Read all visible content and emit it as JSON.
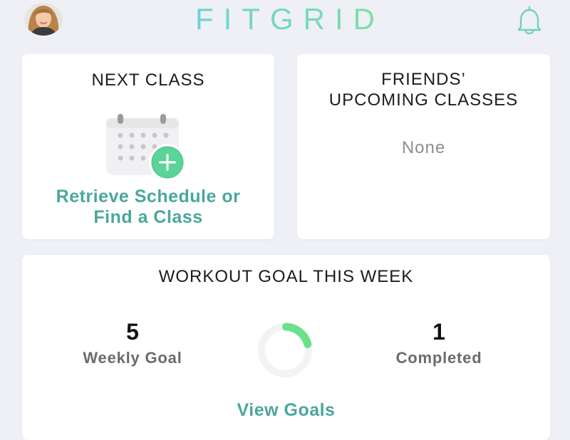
{
  "header": {
    "logo_text": "FITGRID",
    "icons": {
      "avatar": "user-avatar",
      "notifications": "bell-icon"
    }
  },
  "next_class": {
    "title": "NEXT CLASS",
    "icon": "calendar-add-icon",
    "link_line1": "Retrieve Schedule or",
    "link_line2": "Find a Class"
  },
  "friends": {
    "title_line1": "FRIENDS’",
    "title_line2": "UPCOMING CLASSES",
    "empty_text": "None"
  },
  "workout_goal": {
    "title": "WORKOUT GOAL THIS WEEK",
    "weekly_goal_value": "5",
    "weekly_goal_label": "Weekly Goal",
    "completed_value": "1",
    "completed_label": "Completed",
    "progress_fraction": 0.2,
    "view_goals_label": "View Goals"
  },
  "colors": {
    "logo_gradient_start": "#6fd1d8",
    "logo_gradient_end": "#7ee0a2",
    "link": "#4aa79b",
    "progress": "#6be08a",
    "ring_track": "#f2f3f5",
    "background": "#eef0f5"
  }
}
